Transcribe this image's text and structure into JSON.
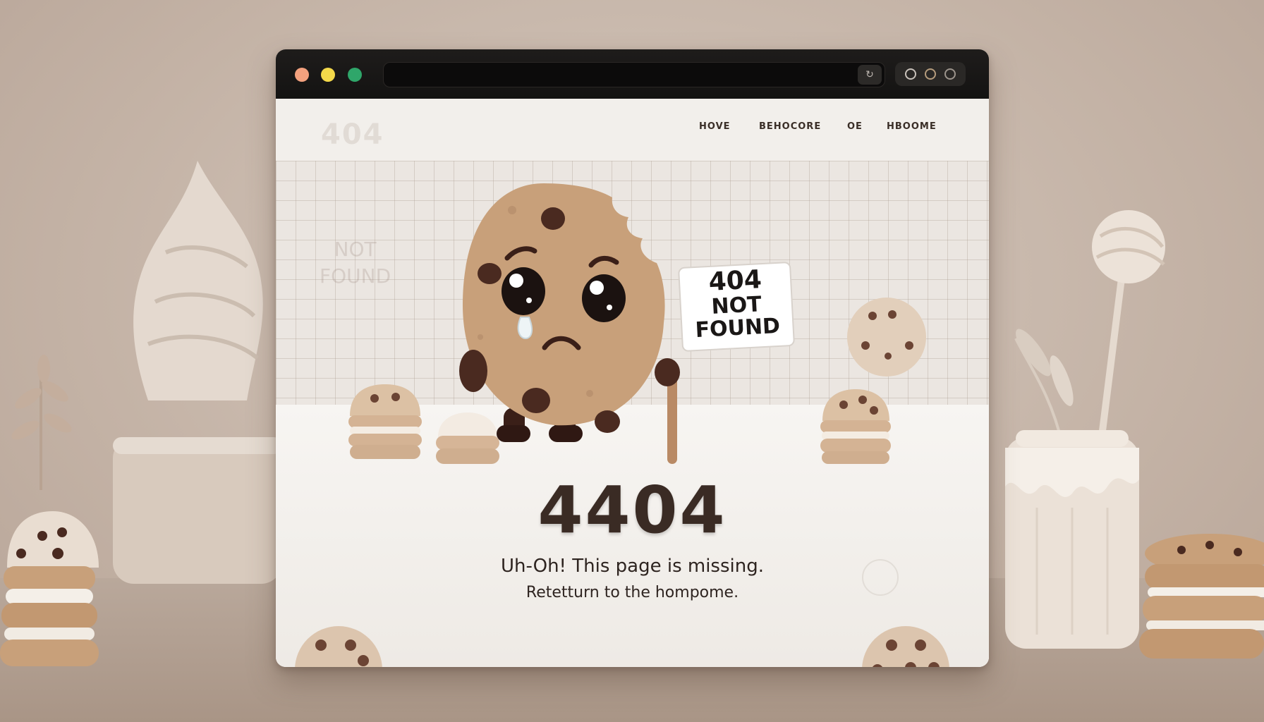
{
  "browser": {
    "address_button_icon": "reload-icon",
    "extensions": [
      "extension-icon",
      "extension-icon",
      "extension-icon"
    ]
  },
  "page": {
    "ghost_code": "404",
    "ghost_not": "NOT",
    "ghost_found": "FOUND",
    "nav": [
      "HOVE",
      "BEHOCORE",
      "OE",
      "HBOOME"
    ],
    "sign_line1": "404",
    "sign_line2": "NOT",
    "sign_line3": "FOUND",
    "error_code": "4404",
    "message": "Uh-Oh! This page is missing.",
    "link_text": "Retetturn to the hompome."
  },
  "colors": {
    "cookie": "#c8a07a",
    "chip": "#4a2a20",
    "accent_red": "#f3a17e",
    "accent_yellow": "#f4d94a",
    "accent_green": "#2fa66a"
  }
}
